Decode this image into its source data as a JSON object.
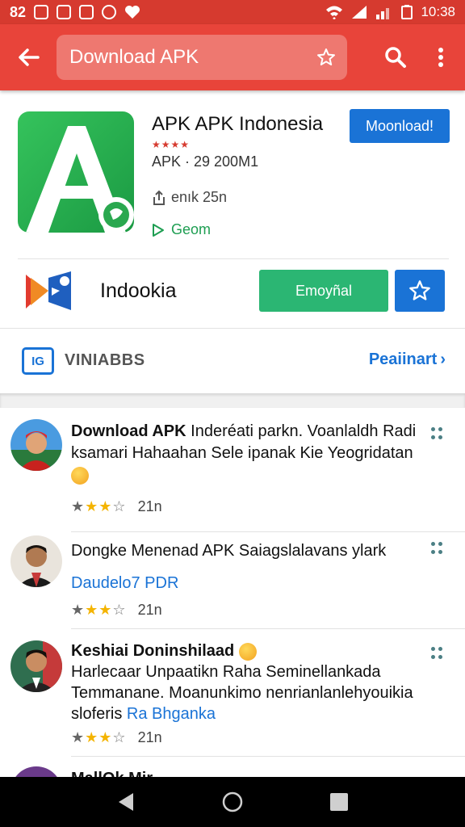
{
  "status_bar": {
    "left_number": "82",
    "time": "10:38"
  },
  "app_bar": {
    "search_text": "Download APK"
  },
  "app": {
    "title": "APK APK Indonesia",
    "stars": "★★★★",
    "meta": "APK  ·  29 200M1",
    "shares": "enık  25n",
    "play_label": "Geom",
    "download_button": "Moonload!"
  },
  "brand": {
    "name": "Indookia",
    "action_button": "Emoyñal"
  },
  "vin": {
    "logo_text": "IG",
    "label": "VINIABBS",
    "link": "Peaiinart",
    "link_chevron": "›"
  },
  "reviews": [
    {
      "head_bold": "Download APK",
      "head_rest": " Inderéati parkn. Voanlaldh Radi ksamari Hahaahan Sele ipanak Kie Yeogridatan",
      "link": "",
      "rating_count": "21n"
    },
    {
      "head_bold": "",
      "head_rest": "Dongke Menenad APK  Saiagslalavans ylark",
      "link": "Daudelo7 PDR",
      "rating_count": "21n"
    },
    {
      "head_bold": "Keshiai Doninshilaad",
      "head_rest": "",
      "body": "Harlecaar Unpaatikn Raha Seminellankada Temmanane. Moanunkimo nenrianlanlehyouikia sloferis",
      "link": "Ra Bhganka",
      "rating_count": "21n"
    },
    {
      "head_bold": "MallOk Mir",
      "head_rest": ""
    }
  ],
  "colors": {
    "status_bar": "#d63a2f",
    "app_bar": "#e8443a",
    "primary_blue": "#1a73d6",
    "green": "#2bb673",
    "star_gold": "#f4b400"
  }
}
